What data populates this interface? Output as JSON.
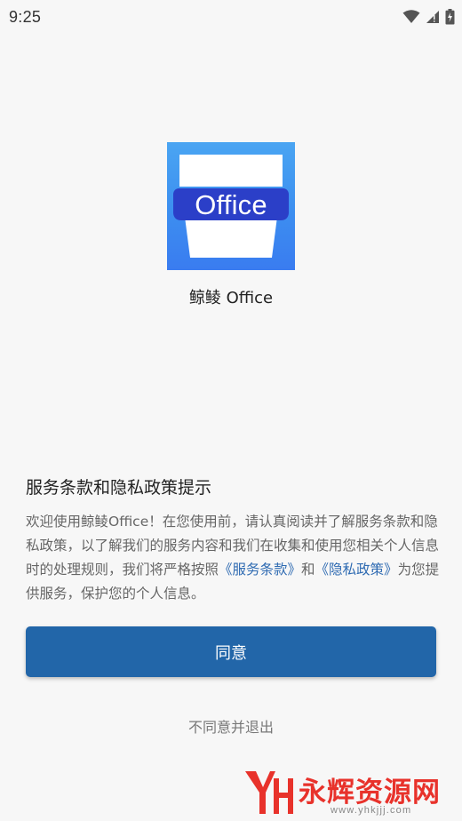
{
  "status_bar": {
    "time": "9:25",
    "icons": [
      "wifi-icon",
      "signal-icon",
      "battery-icon"
    ]
  },
  "app": {
    "icon_label": "Office",
    "name": "鲸鲮 Office",
    "icon_colors": {
      "background": "#3c8ef0",
      "badge": "#2b3fc8",
      "cup": "#ffffff"
    }
  },
  "dialog": {
    "title": "服务条款和隐私政策提示",
    "body_part1": "欢迎使用鲸鲮Office！在您使用前，请认真阅读并了解服务条款和隐私政策，以了解我们的服务内容和我们在收集和使用您相关个人信息时的处理规则，我们将严格按照",
    "terms_link": "《服务条款》",
    "body_and": "和",
    "privacy_link": "《隐私政策》",
    "body_part2": "为您提供服务，保护您的个人信息。"
  },
  "buttons": {
    "agree": "同意",
    "disagree": "不同意并退出"
  },
  "watermark": {
    "text": "永辉资源网",
    "url": "www.yhkjjj.com"
  },
  "colors": {
    "accent": "#2266a9",
    "link": "#2f6bb2",
    "background": "#f7f7f7",
    "watermark": "#e8322b"
  }
}
